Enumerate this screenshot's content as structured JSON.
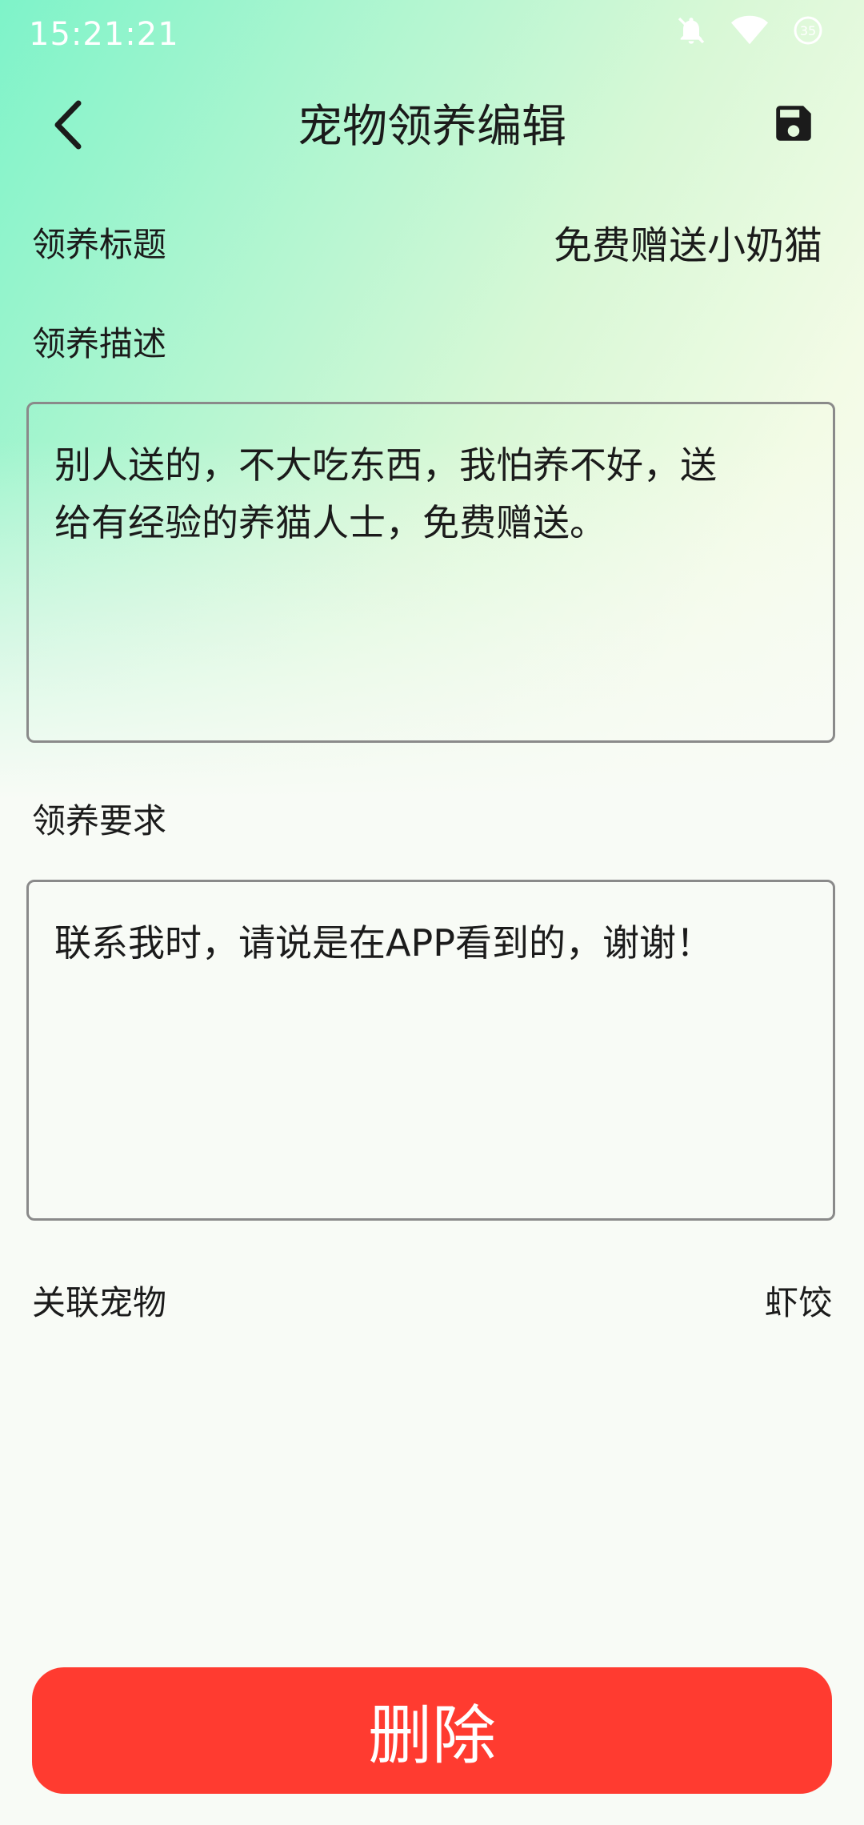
{
  "status_bar": {
    "time": "15:21:21",
    "icons": [
      "notifications-off-icon",
      "wifi-icon",
      "battery-saver-icon"
    ],
    "battery_level": "35"
  },
  "header": {
    "title": "宠物领养编辑",
    "back_icon": "chevron-left-icon",
    "save_icon": "floppy-save-icon"
  },
  "form": {
    "title_label": "领养标题",
    "title_value": "免费赠送小奶猫",
    "description_label": "领养描述",
    "description_value": "别人送的，不大吃东西，我怕养不好，送\n给有经验的养猫人士，免费赠送。",
    "requirement_label": "领养要求",
    "requirement_value": "联系我时，请说是在APP看到的，谢谢！",
    "pet_label": "关联宠物",
    "pet_value": "虾饺"
  },
  "actions": {
    "delete_label": "删除"
  },
  "colors": {
    "accent_gradient_start": "#7ef3c9",
    "accent_gradient_end": "#f3fbe6",
    "delete_button": "#ff3b30",
    "text": "#1b1b1b"
  }
}
